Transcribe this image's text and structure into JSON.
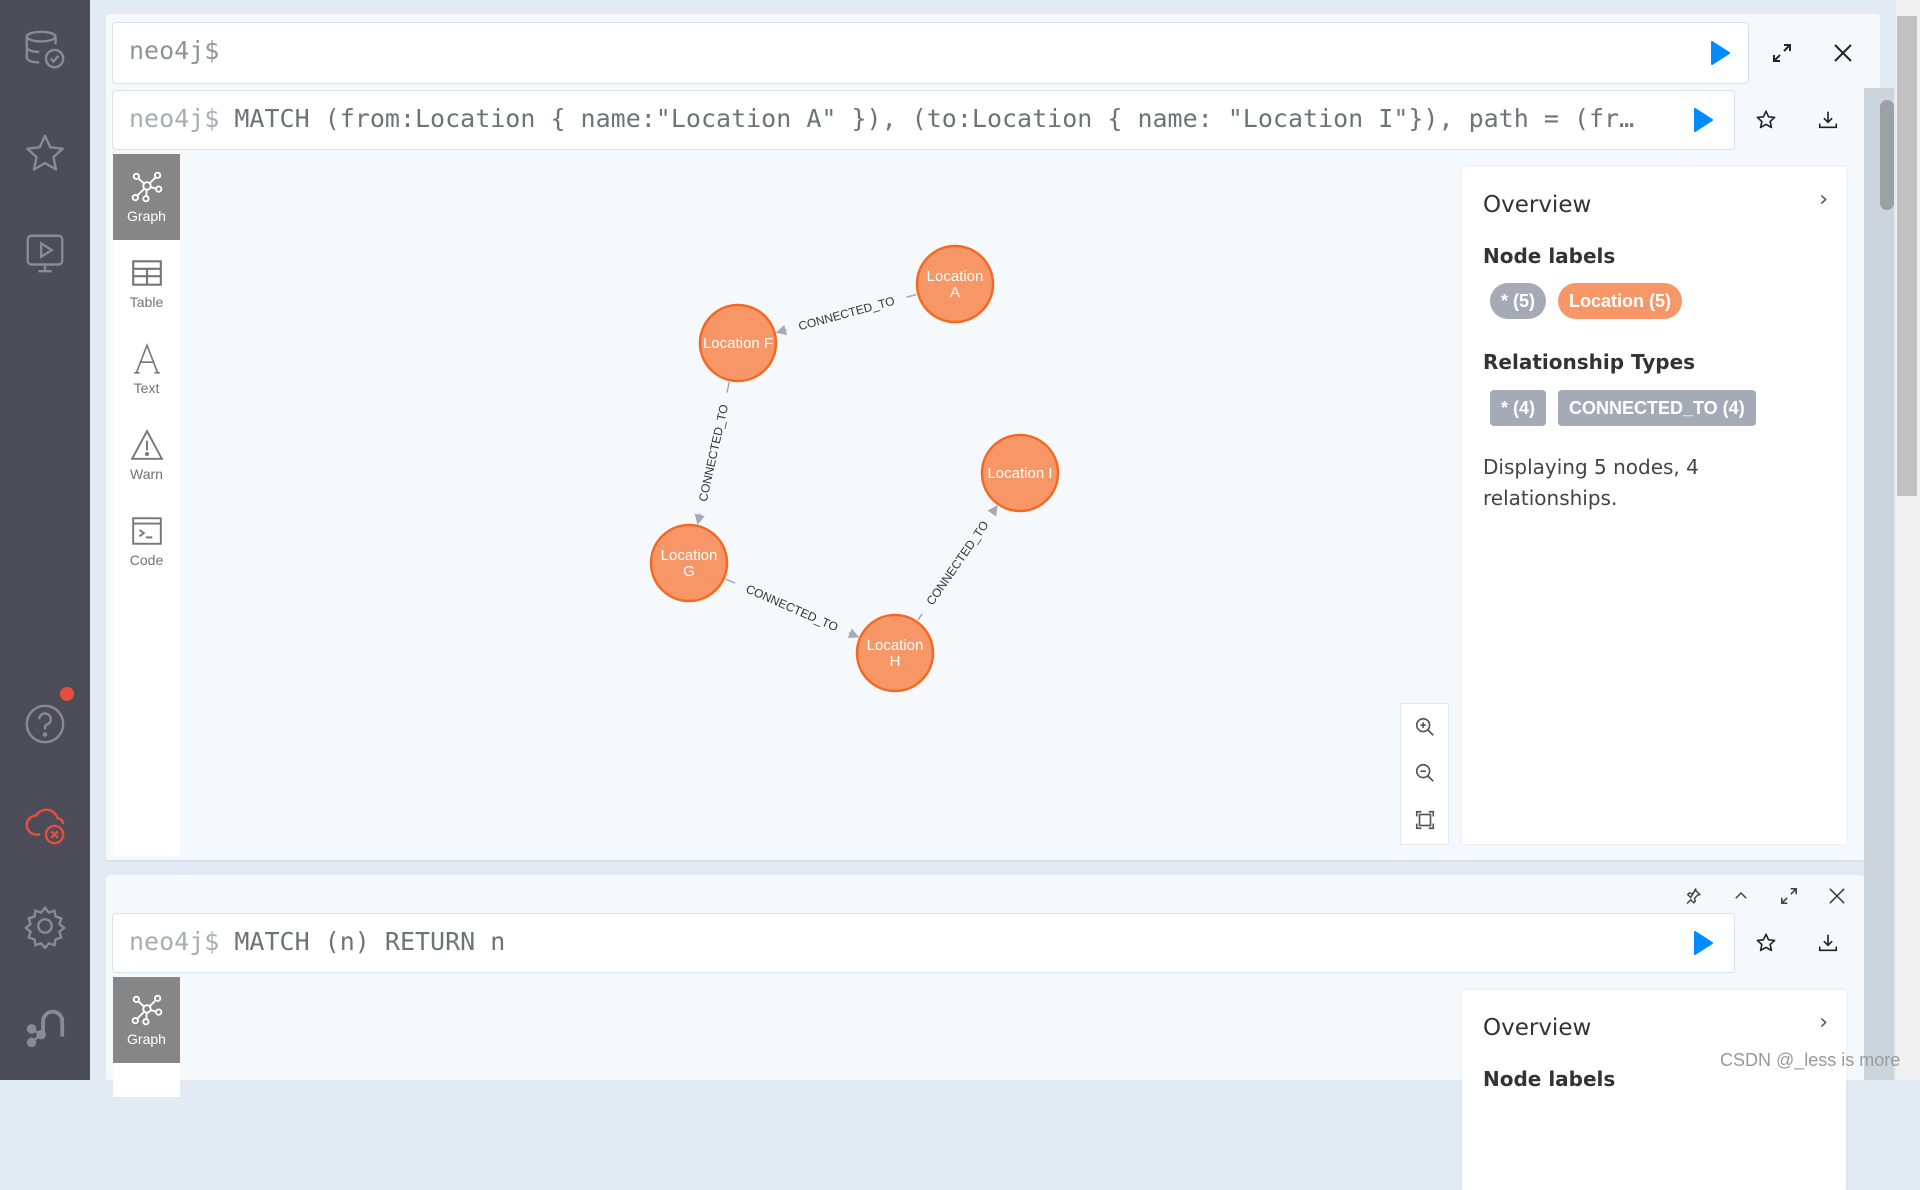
{
  "sidebar": {
    "items": [
      {
        "name": "database",
        "icon": "database-check-icon"
      },
      {
        "name": "favorites",
        "icon": "star-icon"
      },
      {
        "name": "guides",
        "icon": "monitor-play-icon"
      },
      {
        "name": "help",
        "icon": "help-circle-icon",
        "has_notification": true
      },
      {
        "name": "cloud-sync",
        "icon": "cloud-disconnected-icon",
        "status_color": "#e84e3c"
      },
      {
        "name": "settings",
        "icon": "gear-icon"
      },
      {
        "name": "about",
        "icon": "neo4j-logo-icon"
      }
    ]
  },
  "editor": {
    "prompt": "neo4j$",
    "value": "",
    "run_icon": "play-icon",
    "expand_icon": "expand-icon",
    "close_icon": "close-icon"
  },
  "frames": [
    {
      "prompt": "neo4j$",
      "query": "MATCH (from:Location { name:\"Location A\" }), (to:Location { name: \"Location I\"}), path = (fr…",
      "view_tabs": [
        {
          "label": "Graph",
          "active": true
        },
        {
          "label": "Table",
          "active": false
        },
        {
          "label": "Text",
          "active": false
        },
        {
          "label": "Warn",
          "active": false
        },
        {
          "label": "Code",
          "active": false
        }
      ],
      "overview": {
        "title": "Overview",
        "node_labels_title": "Node labels",
        "node_labels": [
          {
            "label": "* (5)",
            "color": "#a5abb6"
          },
          {
            "label": "Location (5)",
            "color": "#f79767"
          }
        ],
        "relationship_types_title": "Relationship Types",
        "relationship_types": [
          {
            "label": "* (4)",
            "color": "#a5abb6"
          },
          {
            "label": "CONNECTED_TO (4)",
            "color": "#a5abb6"
          }
        ],
        "description": "Displaying 5 nodes, 4 relationships."
      },
      "graph": {
        "node_color": "#f79767",
        "node_border": "#f36924",
        "edge_color": "#a5abb6",
        "nodes": [
          {
            "id": "A",
            "lines": [
              "Location",
              "A"
            ]
          },
          {
            "id": "F",
            "lines": [
              "Location F"
            ]
          },
          {
            "id": "G",
            "lines": [
              "Location",
              "G"
            ]
          },
          {
            "id": "H",
            "lines": [
              "Location",
              "H"
            ]
          },
          {
            "id": "I",
            "lines": [
              "Location I"
            ]
          }
        ],
        "relationships": [
          {
            "from": "A",
            "to": "F",
            "type": "CONNECTED_TO"
          },
          {
            "from": "F",
            "to": "G",
            "type": "CONNECTED_TO"
          },
          {
            "from": "G",
            "to": "H",
            "type": "CONNECTED_TO"
          },
          {
            "from": "H",
            "to": "I",
            "type": "CONNECTED_TO"
          }
        ]
      }
    },
    {
      "prompt": "neo4j$",
      "query": "MATCH (n) RETURN n",
      "view_tabs": [
        {
          "label": "Graph",
          "active": true
        }
      ],
      "overview": {
        "title": "Overview",
        "node_labels_title": "Node labels"
      }
    }
  ],
  "watermark": "CSDN @_less is more"
}
